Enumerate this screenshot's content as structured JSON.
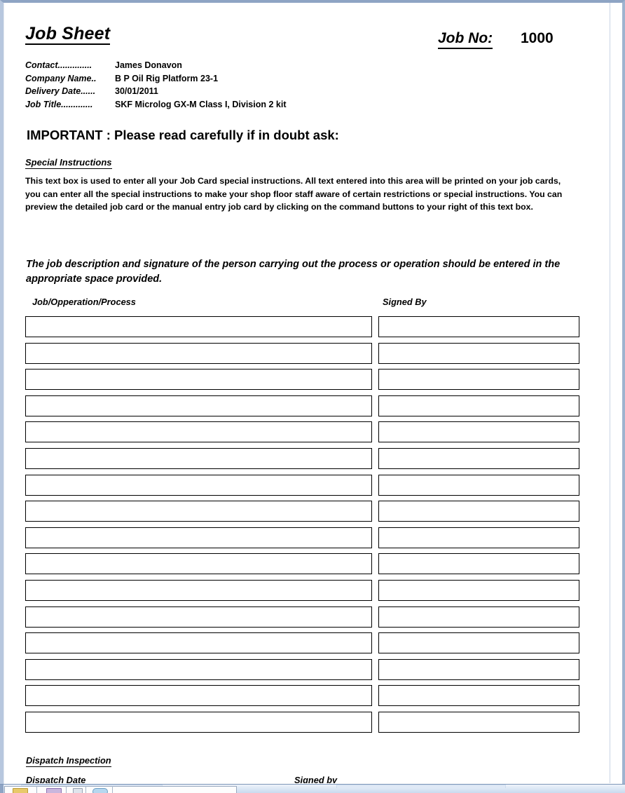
{
  "document": {
    "title": "Job Sheet",
    "job_no_label": "Job No:",
    "job_no_value": "1000",
    "fields": [
      {
        "label": "Contact..............",
        "value": "James Donavon"
      },
      {
        "label": "Company Name..",
        "value": "B P Oil Rig Platform 23-1"
      },
      {
        "label": "Delivery Date......",
        "value": "30/01/2011"
      },
      {
        "label": "Job Title.............",
        "value": "SKF Microlog GX-M Class I, Division 2 kit"
      }
    ],
    "important_notice": "IMPORTANT : Please read carefully if in doubt ask:",
    "special_instructions": {
      "heading": "Special Instructions",
      "body": "This text box is used to enter all your Job Card special instructions. All text entered into this area will be printed on your job cards, you can enter all the special instructions to make your shop floor staff aware of certain restrictions or special instructions. You can preview the detailed job card or the manual entry job card by clicking on the command buttons to your right of this text box."
    },
    "description": "The job description and signature of the person carrying out the process or operation should be entered in the appropriate space provided.",
    "table": {
      "columns": [
        "Job/Opperation/Process",
        "Signed By"
      ],
      "row_count": 16,
      "rows": [
        {
          "job": "",
          "signed_by": ""
        },
        {
          "job": "",
          "signed_by": ""
        },
        {
          "job": "",
          "signed_by": ""
        },
        {
          "job": "",
          "signed_by": ""
        },
        {
          "job": "",
          "signed_by": ""
        },
        {
          "job": "",
          "signed_by": ""
        },
        {
          "job": "",
          "signed_by": ""
        },
        {
          "job": "",
          "signed_by": ""
        },
        {
          "job": "",
          "signed_by": ""
        },
        {
          "job": "",
          "signed_by": ""
        },
        {
          "job": "",
          "signed_by": ""
        },
        {
          "job": "",
          "signed_by": ""
        },
        {
          "job": "",
          "signed_by": ""
        },
        {
          "job": "",
          "signed_by": ""
        },
        {
          "job": "",
          "signed_by": ""
        },
        {
          "job": "",
          "signed_by": ""
        }
      ]
    },
    "dispatch": {
      "heading": "Dispatch Inspection",
      "date_label": "Dispatch Date",
      "signed_label": "Signed by"
    }
  },
  "colors": {
    "page_background": "#ffffff",
    "text": "#000000",
    "window_frame": "#8ea4c4",
    "cell_border": "#000000",
    "toolbar": "#c6d8ee"
  }
}
